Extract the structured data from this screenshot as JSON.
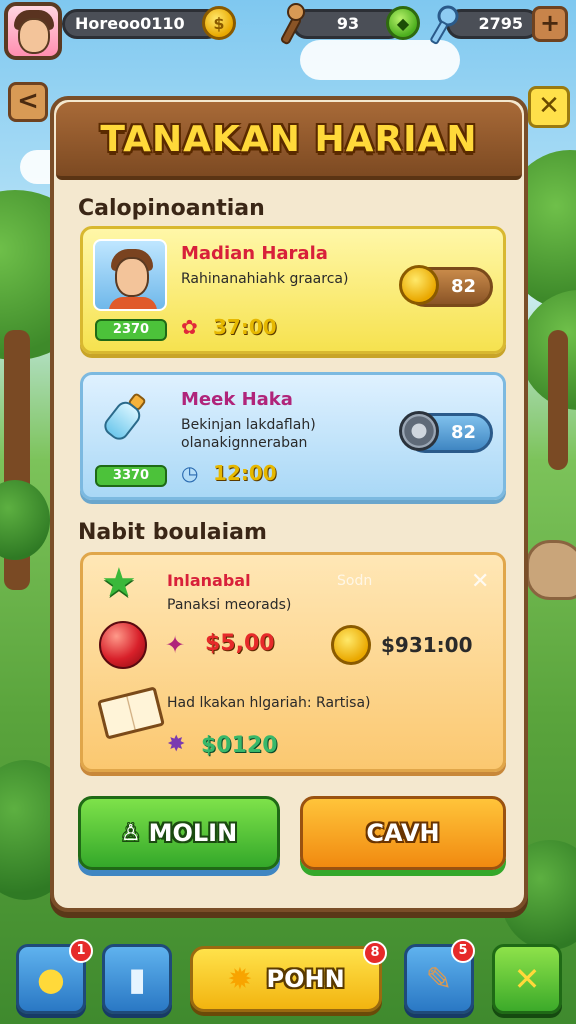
{
  "topbar": {
    "player_name": "Horeoo0110",
    "coin_symbol": "$",
    "energy_value": "93",
    "gem_value": "2795",
    "plus_label": "+"
  },
  "nav": {
    "back_label": "<",
    "close_label": "✕"
  },
  "panel": {
    "title": "TANAKAN HARIAN"
  },
  "section_active": {
    "heading": "Calopinoantian",
    "cards": [
      {
        "name": "Madian Harala",
        "description": "Rahinanahiahk graarca)",
        "level": "2370",
        "time": "37:00",
        "reward_value": "82"
      },
      {
        "name": "Meek Haka",
        "description_line1": "Bekinjan lakdaflah)",
        "description_line2": "olanakignneraban",
        "level": "3370",
        "time": "12:00",
        "reward_value": "82"
      }
    ]
  },
  "section_rewards": {
    "heading": "Nabit boulaiam",
    "title": "Inlanabal",
    "faded_tag": "Sodn",
    "subtitle": "Panaksi meorads)",
    "amount_red": "$5,00",
    "amount_coin": "$931:00",
    "book_description": "Had lkakan hlgariah: Rartisa)",
    "amount_gem": "$0120"
  },
  "buttons": {
    "primary_label": "MOLIN",
    "secondary_label": "CAVH"
  },
  "bottom_nav": {
    "chat_badge": "1",
    "center_label": "POHN",
    "center_badge": "8",
    "quest_badge": "5"
  },
  "colors": {
    "panel_bg": "#f4e8cf",
    "title_gold": "#ffd93a",
    "wood_brown": "#7a4e28",
    "accent_red": "#e62a2a",
    "accent_green": "#4cc23a",
    "accent_orange": "#f18a10"
  },
  "icons": {
    "energy": "torch-icon",
    "gem": "diamond-icon",
    "key": "key-icon",
    "chat": "chat-bubble-icon",
    "card": "card-icon",
    "map": "scroll-icon",
    "tools": "tools-icon"
  }
}
